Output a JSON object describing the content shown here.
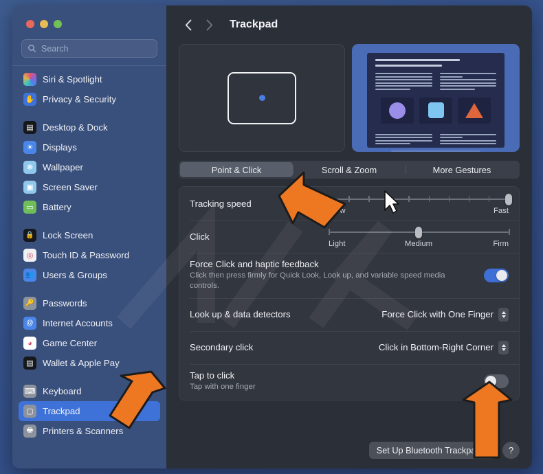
{
  "window": {
    "traffic_lights": [
      "close",
      "minimize",
      "maximize"
    ],
    "colors": {
      "close": "#e8695c",
      "minimize": "#e9bb54",
      "maximize": "#72c157",
      "accent": "#3e72d8",
      "sidebar_bg": "#3a507c",
      "main_bg": "#2b2f38"
    }
  },
  "search": {
    "placeholder": "Search",
    "value": ""
  },
  "sidebar": {
    "groups": [
      {
        "items": [
          {
            "label": "Siri & Spotlight",
            "icon": "siri-icon",
            "selected": false
          },
          {
            "label": "Privacy & Security",
            "icon": "privacy-hand-icon",
            "selected": false
          }
        ]
      },
      {
        "items": [
          {
            "label": "Desktop & Dock",
            "icon": "desktop-dock-icon",
            "selected": false
          },
          {
            "label": "Displays",
            "icon": "displays-icon",
            "selected": false
          },
          {
            "label": "Wallpaper",
            "icon": "wallpaper-icon",
            "selected": false
          },
          {
            "label": "Screen Saver",
            "icon": "screen-saver-icon",
            "selected": false
          },
          {
            "label": "Battery",
            "icon": "battery-icon",
            "selected": false
          }
        ]
      },
      {
        "items": [
          {
            "label": "Lock Screen",
            "icon": "lock-screen-icon",
            "selected": false
          },
          {
            "label": "Touch ID & Password",
            "icon": "touch-id-icon",
            "selected": false
          },
          {
            "label": "Users & Groups",
            "icon": "users-groups-icon",
            "selected": false
          }
        ]
      },
      {
        "items": [
          {
            "label": "Passwords",
            "icon": "passwords-key-icon",
            "selected": false
          },
          {
            "label": "Internet Accounts",
            "icon": "internet-accounts-icon",
            "selected": false
          },
          {
            "label": "Game Center",
            "icon": "game-center-icon",
            "selected": false
          },
          {
            "label": "Wallet & Apple Pay",
            "icon": "wallet-icon",
            "selected": false
          }
        ]
      },
      {
        "items": [
          {
            "label": "Keyboard",
            "icon": "keyboard-icon",
            "selected": false
          },
          {
            "label": "Trackpad",
            "icon": "trackpad-icon",
            "selected": true
          },
          {
            "label": "Printers & Scanners",
            "icon": "printers-scanners-icon",
            "selected": false
          }
        ]
      }
    ]
  },
  "header": {
    "title": "Trackpad",
    "back_enabled": true,
    "forward_enabled": false
  },
  "preview": {
    "left_name": "trackpad-illustration",
    "right_name": "desktop-preview",
    "dock_colors": [
      "#4a86e8",
      "#e8b23c",
      "#e06a5e",
      "#6fbe5a",
      "#e8c84a",
      "#f2f2f2",
      "#7ec6ef",
      "#9b8ee8",
      "#5f6470",
      "#6fbe5a",
      "#b9bcc3"
    ]
  },
  "tabs": [
    {
      "label": "Point & Click",
      "active": true
    },
    {
      "label": "Scroll & Zoom",
      "active": false
    },
    {
      "label": "More Gestures",
      "active": false
    }
  ],
  "settings": {
    "tracking_speed": {
      "label": "Tracking speed",
      "min_label": "Slow",
      "max_label": "Fast",
      "ticks": 10,
      "value_percent": 100
    },
    "click": {
      "label": "Click",
      "min_label": "Light",
      "mid_label": "Medium",
      "max_label": "Firm",
      "value_percent": 50
    },
    "force_click": {
      "label": "Force Click and haptic feedback",
      "description": "Click then press firmly for Quick Look, Look up, and variable speed media controls.",
      "enabled": true
    },
    "look_up": {
      "label": "Look up & data detectors",
      "value": "Force Click with One Finger"
    },
    "secondary_click": {
      "label": "Secondary click",
      "value": "Click in Bottom-Right Corner"
    },
    "tap_to_click": {
      "label": "Tap to click",
      "description": "Tap with one finger",
      "enabled": false
    }
  },
  "footer": {
    "setup_button": "Set Up Bluetooth Trackpad...",
    "help_button": "?"
  },
  "annotations": {
    "arrow_color": "#ee7722",
    "arrows": [
      "points-at-point-and-click-tab",
      "points-at-trackpad-sidebar-item",
      "points-at-tap-to-click-toggle"
    ]
  }
}
